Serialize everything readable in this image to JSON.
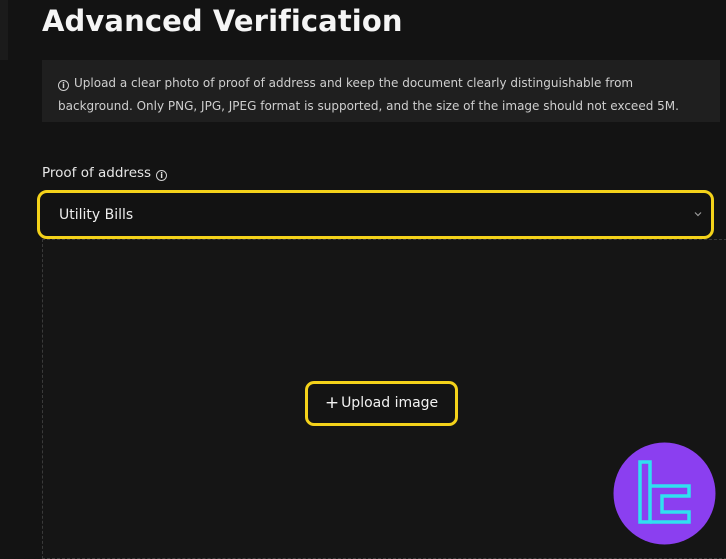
{
  "header": {
    "title": "Advanced Verification"
  },
  "notice": {
    "icon": "info-icon",
    "text": "Upload a clear photo of proof of address and keep the document clearly distinguishable from background. Only PNG, JPG, JPEG format is supported, and the size of the image should not exceed 5M."
  },
  "proof": {
    "label": "Proof of address",
    "label_icon": "info-icon",
    "selected": "Utility Bills",
    "chevron_icon": "chevron-down-icon"
  },
  "upload": {
    "plus_icon": "plus-icon",
    "plus": "+",
    "label": "Upload image"
  },
  "logo": {
    "icon": "brand-logo",
    "colors": {
      "circle": "#8b3ff0",
      "mark": "#30e0f0"
    }
  },
  "colors": {
    "background": "#131313",
    "highlight": "#f4d21a",
    "panel": "#1f1f1f"
  }
}
